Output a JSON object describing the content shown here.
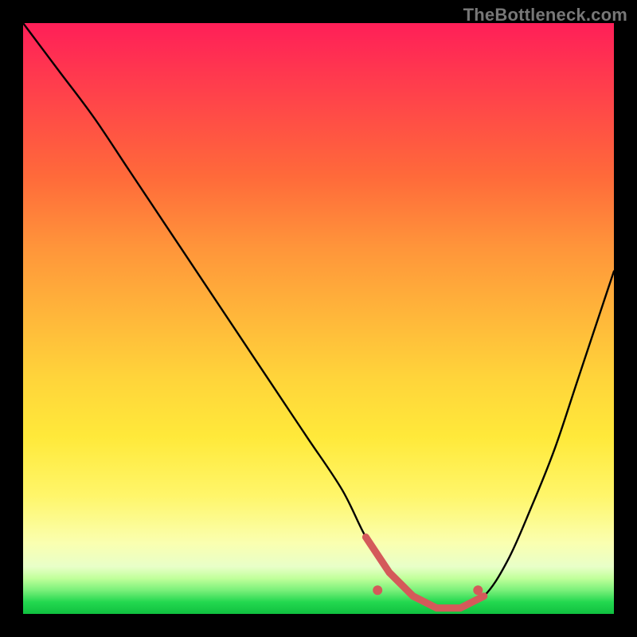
{
  "watermark": "TheBottleneck.com",
  "chart_data": {
    "type": "line",
    "title": "",
    "xlabel": "",
    "ylabel": "",
    "xlim": [
      0,
      100
    ],
    "ylim": [
      0,
      100
    ],
    "series": [
      {
        "name": "bottleneck-curve",
        "x": [
          0,
          6,
          12,
          18,
          24,
          30,
          36,
          42,
          48,
          54,
          58,
          62,
          66,
          70,
          74,
          78,
          82,
          86,
          90,
          94,
          100
        ],
        "values": [
          100,
          92,
          84,
          75,
          66,
          57,
          48,
          39,
          30,
          21,
          13,
          7,
          3,
          1,
          1,
          3,
          9,
          18,
          28,
          40,
          58
        ]
      }
    ],
    "markers": [
      {
        "name": "range-start",
        "x": 60,
        "y": 4
      },
      {
        "name": "range-end",
        "x": 77,
        "y": 4
      }
    ],
    "background_gradient": {
      "top": "#ff1f58",
      "mid": "#ffe93a",
      "bottom": "#10c040"
    }
  }
}
